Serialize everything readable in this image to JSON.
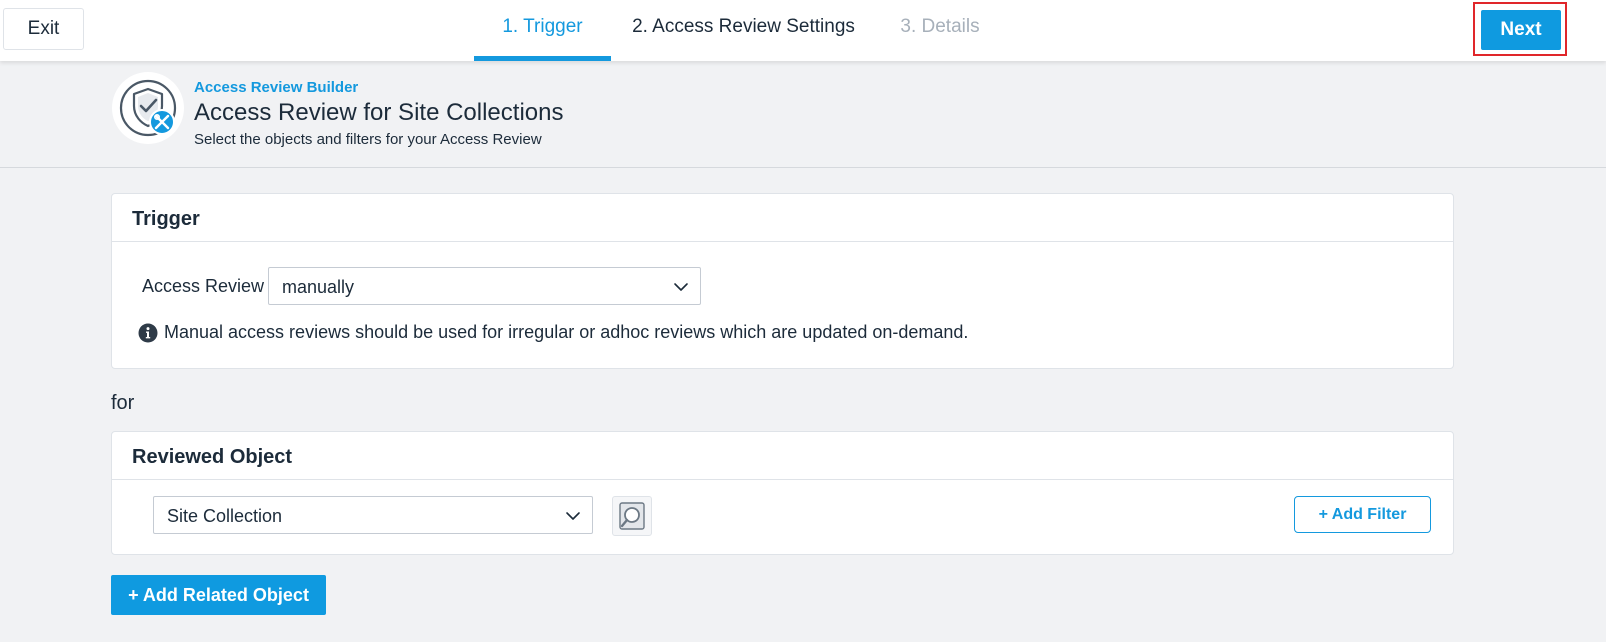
{
  "topbar": {
    "exit_label": "Exit",
    "steps": [
      {
        "label": "1. Trigger",
        "state": "active"
      },
      {
        "label": "2. Access Review Settings",
        "state": "normal"
      },
      {
        "label": "3. Details",
        "state": "disabled"
      }
    ],
    "next_label": "Next"
  },
  "header": {
    "eyebrow": "Access Review Builder",
    "title": "Access Review for Site Collections",
    "subtitle": "Select the objects and filters for your Access Review",
    "logo_icon": "shield-check-tools-icon"
  },
  "trigger_card": {
    "title": "Trigger",
    "field_label": "Access Review",
    "select_value": "manually",
    "info_icon": "info-circle-icon",
    "info_text": "Manual access reviews should be used for irregular or adhoc reviews which are updated on-demand."
  },
  "for_label": "for",
  "reviewed_card": {
    "title": "Reviewed Object",
    "select_value": "Site Collection",
    "search_icon": "object-search-icon",
    "add_filter_label": "+ Add Filter"
  },
  "add_related_label": "+ Add Related Object",
  "colors": {
    "accent": "#1499de",
    "primary_button": "#0f9ae0",
    "highlight_border": "#e0262a"
  }
}
